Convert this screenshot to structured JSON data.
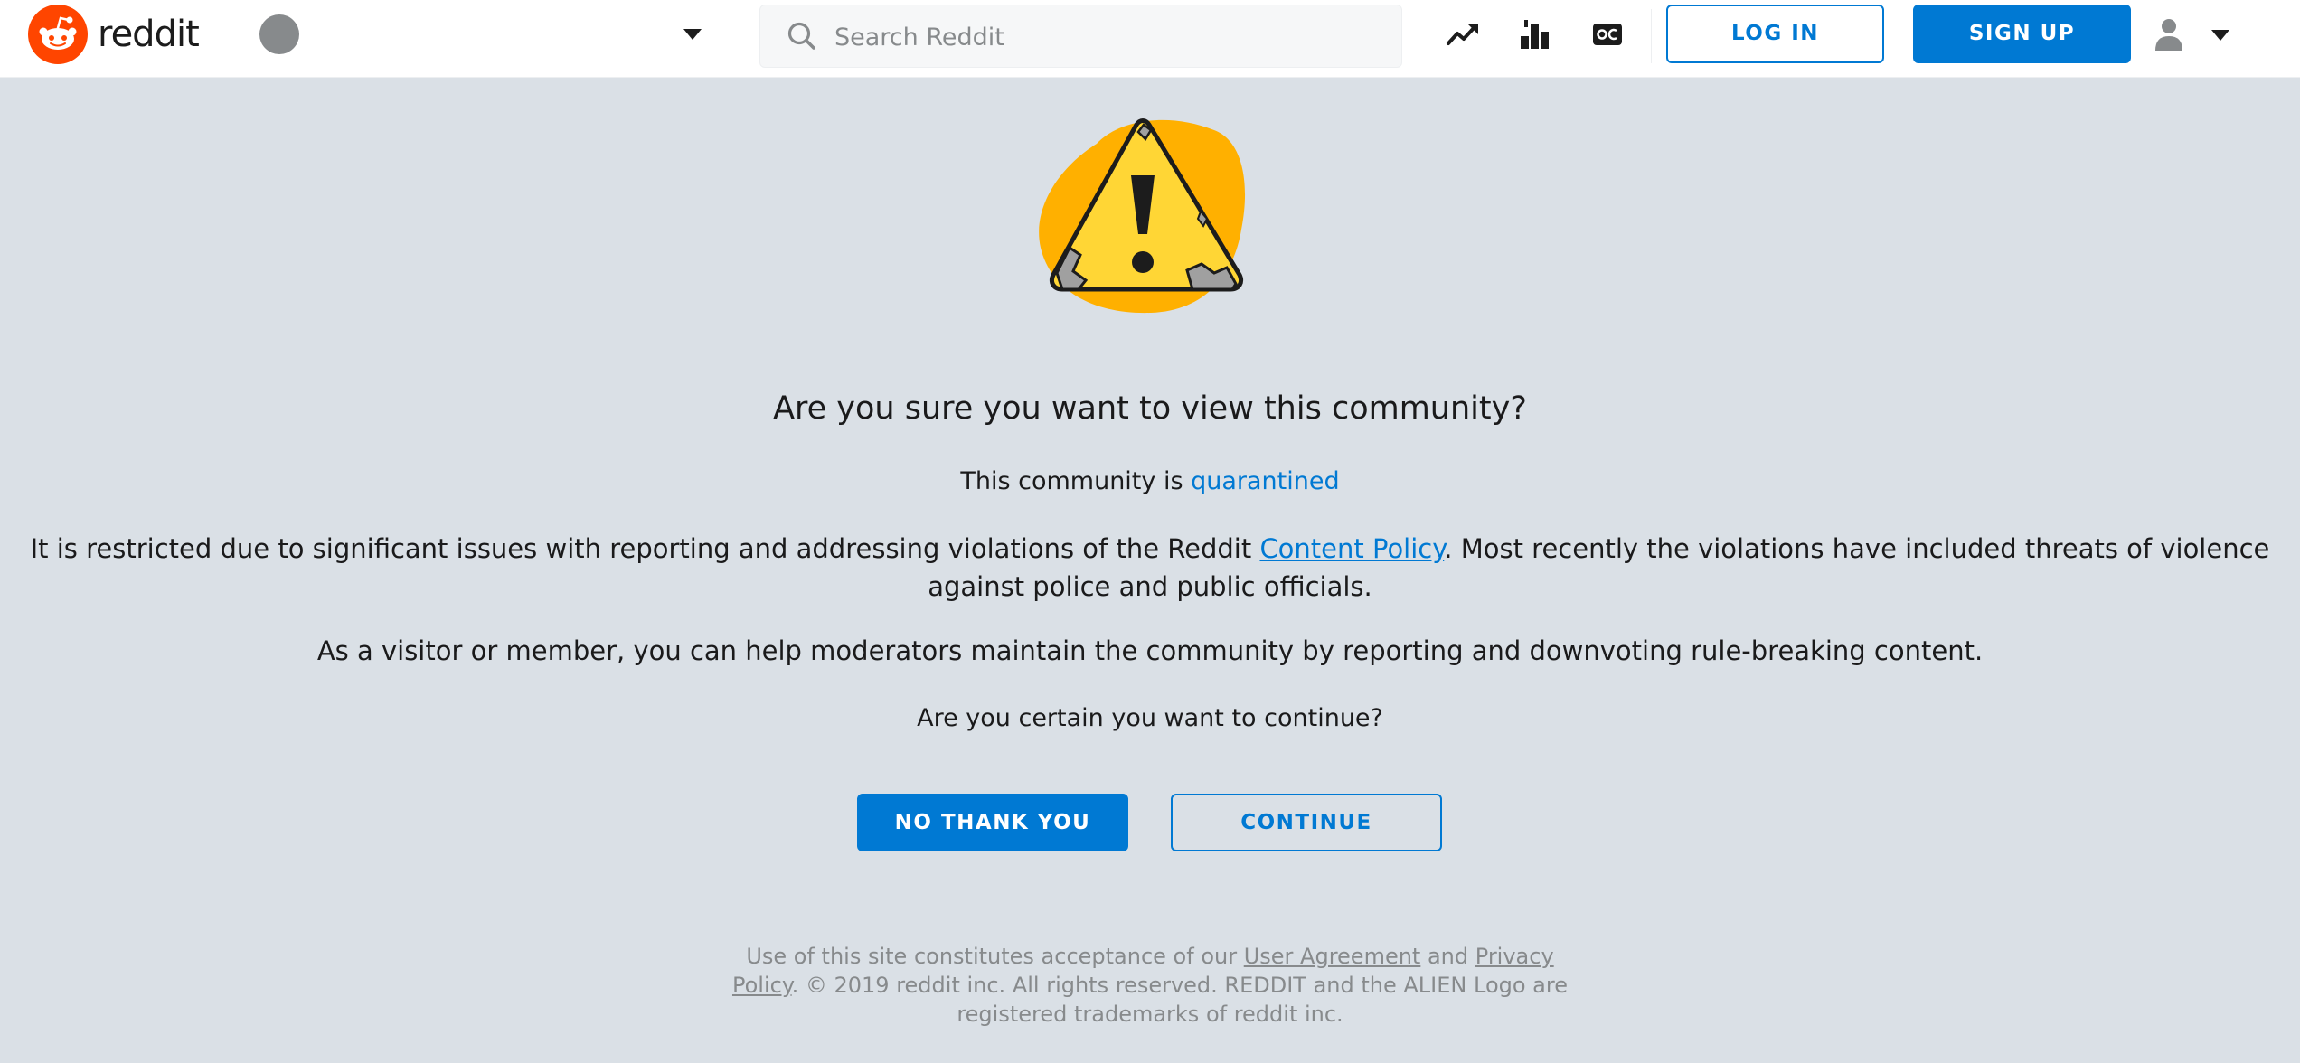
{
  "header": {
    "wordmark": "reddit",
    "search_placeholder": "Search Reddit",
    "icons": [
      "trending-icon",
      "leaderboard-icon",
      "oc-icon"
    ],
    "login_label": "LOG IN",
    "signup_label": "SIGN UP"
  },
  "main": {
    "title": "Are you sure you want to view this community?",
    "subtitle_prefix": "This community is ",
    "subtitle_link": "quarantined",
    "para1_before": "It is restricted due to significant issues with reporting and addressing violations of the Reddit ",
    "para1_link": "Content Policy",
    "para1_after": ". Most recently the violations have included threats of violence against police and public officials.",
    "para2": "As a visitor or member, you can help moderators maintain the community by reporting and downvoting rule-breaking content.",
    "question": "Are you certain you want to continue?",
    "no_label": "NO THANK YOU",
    "continue_label": "CONTINUE"
  },
  "footer": {
    "text_before": "Use of this site constitutes acceptance of our ",
    "user_agreement": "User Agreement",
    "and": " and ",
    "privacy_policy": "Privacy Policy",
    "text_after": ". © 2019 reddit inc. All rights reserved. REDDIT and the ALIEN Logo are registered trademarks of reddit inc."
  },
  "colors": {
    "brand": "#ff4500",
    "accent": "#0079d3",
    "background": "#dae0e6",
    "warning_yellow": "#ffd635",
    "warning_orange": "#ffb000"
  }
}
